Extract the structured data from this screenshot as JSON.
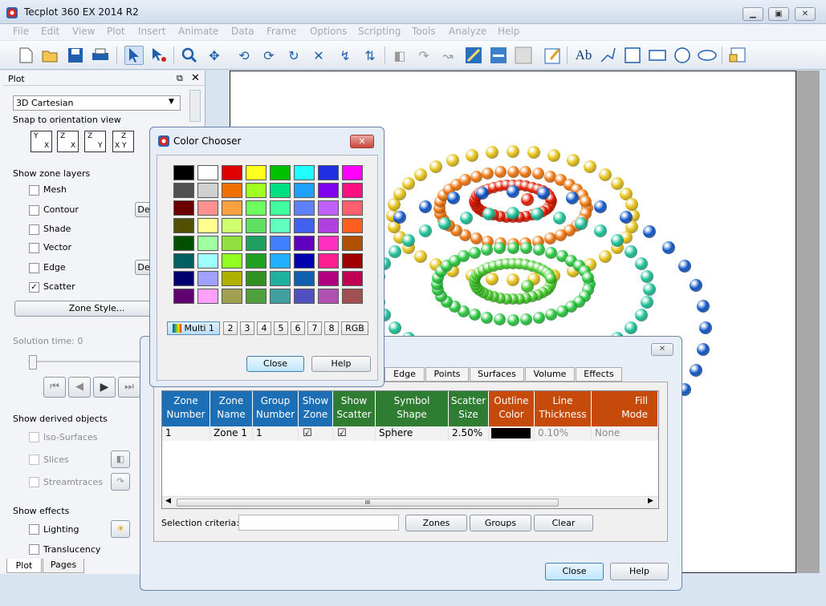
{
  "app": {
    "title": "Tecplot 360 EX 2014 R2",
    "accent": "#2860b8"
  },
  "window_controls": {
    "min": "▁",
    "max": "▣",
    "close": "✕"
  },
  "menu": [
    "File",
    "Edit",
    "View",
    "Plot",
    "Insert",
    "Animate",
    "Data",
    "Frame",
    "Options",
    "Scripting",
    "Tools",
    "Analyze",
    "Help"
  ],
  "toolbar": {
    "icons": [
      "new-file-icon",
      "open-file-icon",
      "save-icon",
      "print-icon",
      "select-arrow-icon",
      "adjustor-icon",
      "zoom-icon",
      "translate-icon",
      "rotate-x-icon",
      "rotate-y-icon",
      "spin-icon",
      "rotate-xy-icon",
      "rotate-zx-icon",
      "rotate-z-icon",
      "probe-icon",
      "slice-icon",
      "streamtrace-icon",
      "add-contour-icon",
      "remove-contour-icon",
      "level-icon",
      "edit-icon",
      "text-tool-icon",
      "line-tool-icon",
      "rectangle-frame-icon",
      "rectangle-icon",
      "circle-icon",
      "ellipse-icon",
      "add-frame-icon"
    ],
    "text_icon": "Ab"
  },
  "plot_panel": {
    "title": "Plot",
    "plot_type": "3D Cartesian",
    "snap_label": "Snap to orientation view",
    "snap_buttons": [
      {
        "a": "Y",
        "b": "X"
      },
      {
        "a": "Z",
        "b": "X"
      },
      {
        "a": "Z",
        "b": "Y"
      },
      {
        "a": "Z",
        "b": "X Y"
      }
    ],
    "zone_layers_label": "Show zone layers",
    "layers": [
      {
        "label": "Mesh",
        "checked": false
      },
      {
        "label": "Contour",
        "checked": false
      },
      {
        "label": "Shade",
        "checked": false
      },
      {
        "label": "Vector",
        "checked": false
      },
      {
        "label": "Edge",
        "checked": false
      },
      {
        "label": "Scatter",
        "checked": true
      }
    ],
    "de_button": "De",
    "zone_style_button": "Zone Style...",
    "solution_time_label": "Solution time: 0",
    "derived_label": "Show derived objects",
    "derived": [
      "Iso-Surfaces",
      "Slices",
      "Streamtraces"
    ],
    "effects_label": "Show effects",
    "effects": [
      "Lighting",
      "Translucency"
    ],
    "tabs": [
      "Plot",
      "Pages"
    ]
  },
  "color_chooser": {
    "title": "Color Chooser",
    "palette": [
      [
        "#000000",
        "#ffffff",
        "#e00000",
        "#ffff20",
        "#00c000",
        "#20ffff",
        "#2030e0",
        "#ff00ff"
      ],
      [
        "#505050",
        "#d0d0d0",
        "#f07000",
        "#a0ff20",
        "#00e080",
        "#20a0ff",
        "#8000f0",
        "#ff1080"
      ],
      [
        "#6a0000",
        "#ff9090",
        "#ffa040",
        "#70ff60",
        "#40ffa0",
        "#6080ff",
        "#c060ff",
        "#ff6070"
      ],
      [
        "#505000",
        "#ffff90",
        "#d0ff70",
        "#60e060",
        "#60ffc0",
        "#4060f0",
        "#b040e0",
        "#ff6020"
      ],
      [
        "#005000",
        "#a0ffa0",
        "#90e040",
        "#20a060",
        "#4080ff",
        "#6000c0",
        "#ff30c0",
        "#b05000"
      ],
      [
        "#006060",
        "#a0ffff",
        "#90ff20",
        "#20a020",
        "#20b0ff",
        "#0000b0",
        "#ff2090",
        "#a00000"
      ],
      [
        "#000070",
        "#a0a0ff",
        "#b0b000",
        "#309020",
        "#20b0a0",
        "#1060b0",
        "#b00080",
        "#c00050"
      ],
      [
        "#600070",
        "#ffa0ff",
        "#a0a050",
        "#50a040",
        "#40a0a0",
        "#5050c0",
        "#b050b0",
        "#a05050"
      ]
    ],
    "tabs": [
      "Multi 1",
      "2",
      "3",
      "4",
      "5",
      "6",
      "7",
      "8",
      "RGB"
    ],
    "close": "Close",
    "help": "Help"
  },
  "zone_style": {
    "tabs": [
      "Edge",
      "Points",
      "Surfaces",
      "Volume",
      "Effects"
    ],
    "columns": [
      {
        "label": "Zone\nNumber",
        "color": "#1d6fb5"
      },
      {
        "label": "Zone\nName",
        "color": "#1d6fb5"
      },
      {
        "label": "Group\nNumber",
        "color": "#1d6fb5"
      },
      {
        "label": "Show\nZone",
        "color": "#1d6fb5"
      },
      {
        "label": "Show\nScatter",
        "color": "#2e7d32"
      },
      {
        "label": "Symbol\nShape",
        "color": "#2e7d32"
      },
      {
        "label": "Scatter\nSize",
        "color": "#2e7d32"
      },
      {
        "label": "Outline\nColor",
        "color": "#c64a0a"
      },
      {
        "label": "Line\nThickness",
        "color": "#c64a0a"
      },
      {
        "label": "Fill\nMode",
        "color": "#c64a0a"
      }
    ],
    "row": [
      "1",
      "Zone 1",
      "1",
      "☑",
      "☑",
      "Sphere",
      "2.50%",
      "",
      "0.10%",
      "None"
    ],
    "scroll_thumb": "III",
    "selection_label": "Selection criteria:",
    "zones_button": "Zones",
    "groups_button": "Groups",
    "clear_button": "Clear",
    "close": "Close",
    "help": "Help"
  }
}
